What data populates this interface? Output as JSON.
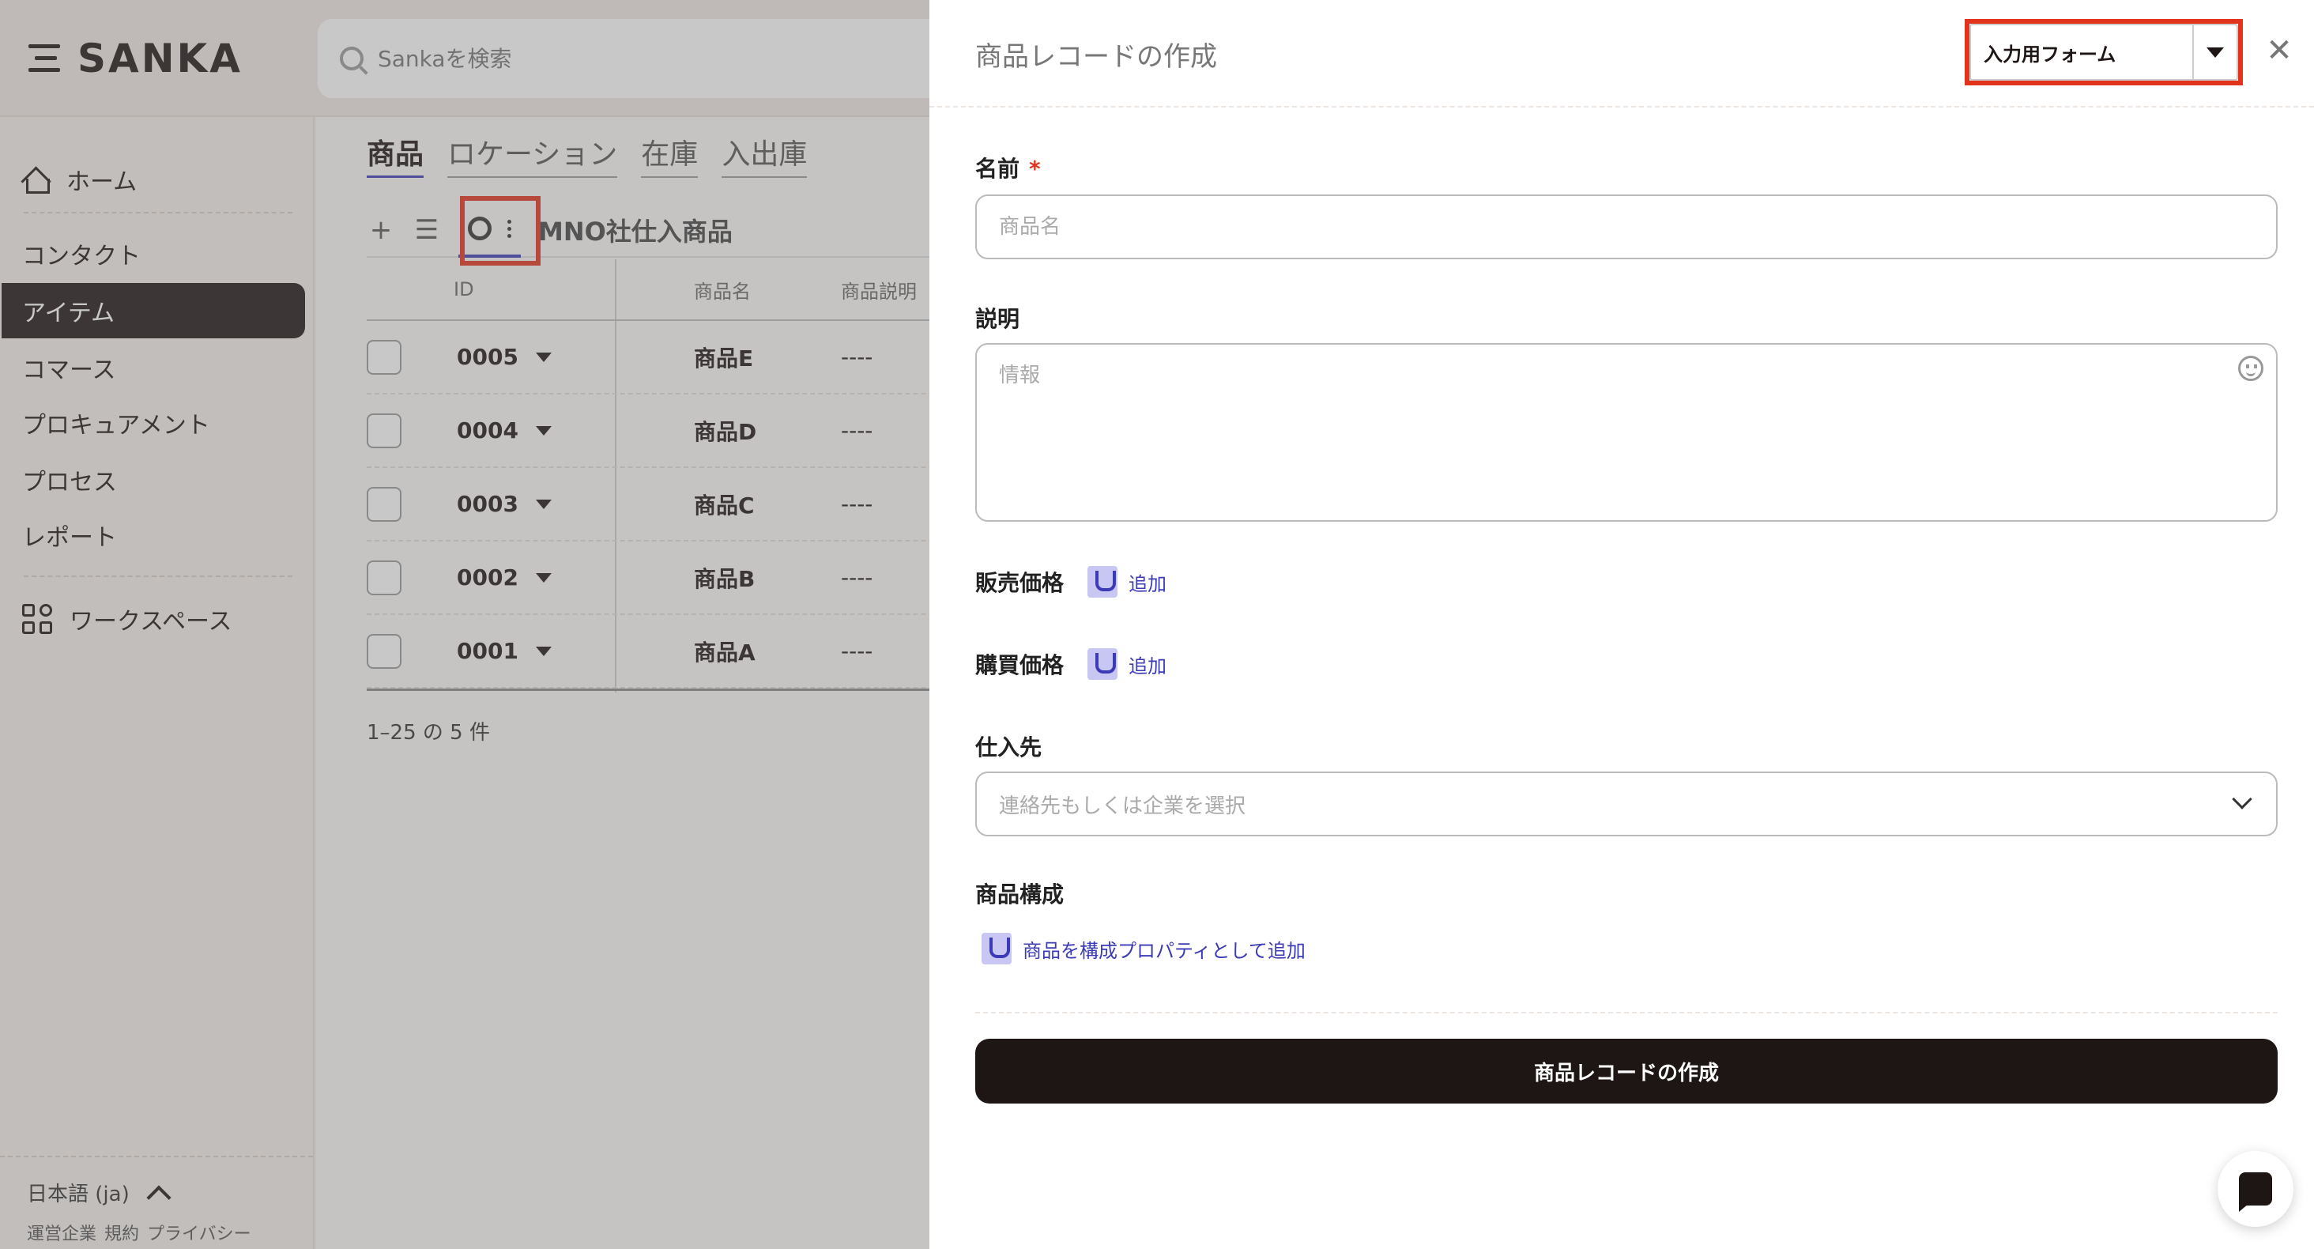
{
  "app": {
    "brand": "SANKA",
    "search_placeholder": "Sankaを検索"
  },
  "sidebar": {
    "items": [
      {
        "label": "ホーム",
        "icon": "home-icon"
      },
      {
        "label": "コンタクト"
      },
      {
        "label": "アイテム",
        "active": true
      },
      {
        "label": "コマース"
      },
      {
        "label": "プロキュアメント"
      },
      {
        "label": "プロセス"
      },
      {
        "label": "レポート"
      },
      {
        "label": "ワークスペース",
        "icon": "workspace-icon"
      }
    ],
    "language": "日本語 (ja)",
    "footer_links": [
      "運営企業",
      "規約",
      "プライバシー"
    ]
  },
  "main": {
    "tabs": [
      "商品",
      "ロケーション",
      "在庫",
      "入出庫"
    ],
    "view_title": "MNO社仕入商品",
    "add_symbol": "+",
    "list_symbol": "☰",
    "columns": [
      "ID",
      "商品名",
      "商品説明"
    ],
    "rows": [
      {
        "id": "0005",
        "name": "商品E",
        "desc": "----"
      },
      {
        "id": "0004",
        "name": "商品D",
        "desc": "----"
      },
      {
        "id": "0003",
        "name": "商品C",
        "desc": "----"
      },
      {
        "id": "0002",
        "name": "商品B",
        "desc": "----"
      },
      {
        "id": "0001",
        "name": "商品A",
        "desc": "----"
      }
    ],
    "pagination": "1–25 の 5 件"
  },
  "panel": {
    "title": "商品レコードの作成",
    "form_select": "入力用フォーム",
    "close_symbol": "✕",
    "name_label": "名前",
    "required_mark": "*",
    "name_placeholder": "商品名",
    "desc_label": "説明",
    "desc_placeholder": "情報",
    "sale_price_label": "販売価格",
    "purchase_price_label": "購買価格",
    "add_text": "追加",
    "supplier_label": "仕入先",
    "supplier_placeholder": "連絡先もしくは企業を選択",
    "composition_label": "商品構成",
    "composition_add": "商品を構成プロパティとして追加",
    "submit": "商品レコードの作成"
  },
  "colors": {
    "brand_dark": "#1d1614",
    "accent": "#3b3bb5",
    "highlight": "#e2331c"
  }
}
